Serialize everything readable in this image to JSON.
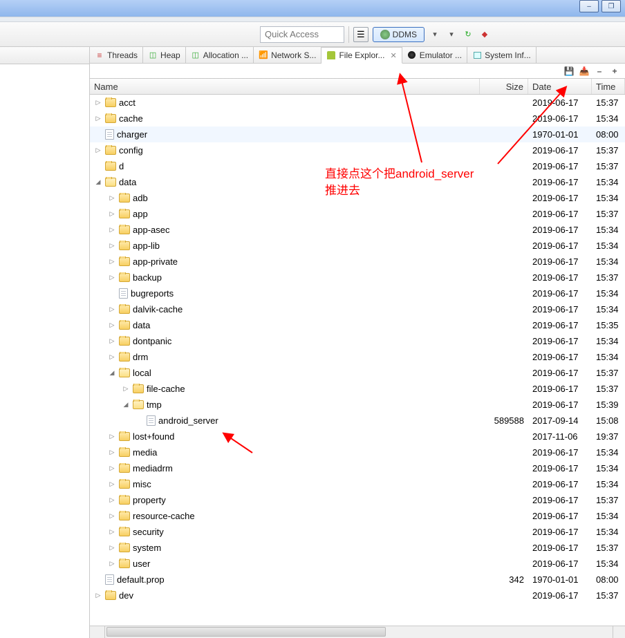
{
  "window": {
    "minimize": "–",
    "maximize": "❐"
  },
  "toolbar": {
    "quick_access_placeholder": "Quick Access",
    "ddms_label": "DDMS"
  },
  "tabs": [
    {
      "icon": "threads-icon",
      "label": "Threads"
    },
    {
      "icon": "heap-icon",
      "label": "Heap"
    },
    {
      "icon": "allocation-icon",
      "label": "Allocation ..."
    },
    {
      "icon": "network-icon",
      "label": "Network S..."
    },
    {
      "icon": "android-icon",
      "label": "File Explor...",
      "active": true,
      "closable": true
    },
    {
      "icon": "emulator-icon",
      "label": "Emulator ..."
    },
    {
      "icon": "system-icon",
      "label": "System Inf..."
    }
  ],
  "columns": {
    "name": "Name",
    "size": "Size",
    "date": "Date",
    "time": "Time"
  },
  "tree": [
    {
      "d": 0,
      "k": "fc",
      "n": "acct",
      "s": "",
      "dt": "2019-06-17",
      "tm": "15:37"
    },
    {
      "d": 0,
      "k": "fc",
      "n": "cache",
      "s": "",
      "dt": "2019-06-17",
      "tm": "15:34"
    },
    {
      "d": 0,
      "k": "fi",
      "n": "charger",
      "s": "",
      "dt": "1970-01-01",
      "tm": "08:00",
      "sel": true,
      "leaf": true
    },
    {
      "d": 0,
      "k": "fc",
      "n": "config",
      "s": "",
      "dt": "2019-06-17",
      "tm": "15:37"
    },
    {
      "d": 0,
      "k": "f",
      "n": "d",
      "s": "",
      "dt": "2019-06-17",
      "tm": "15:37",
      "leaf": true
    },
    {
      "d": 0,
      "k": "fo",
      "n": "data",
      "s": "",
      "dt": "2019-06-17",
      "tm": "15:34"
    },
    {
      "d": 1,
      "k": "fc",
      "n": "adb",
      "s": "",
      "dt": "2019-06-17",
      "tm": "15:34"
    },
    {
      "d": 1,
      "k": "fc",
      "n": "app",
      "s": "",
      "dt": "2019-06-17",
      "tm": "15:37"
    },
    {
      "d": 1,
      "k": "fc",
      "n": "app-asec",
      "s": "",
      "dt": "2019-06-17",
      "tm": "15:34"
    },
    {
      "d": 1,
      "k": "fc",
      "n": "app-lib",
      "s": "",
      "dt": "2019-06-17",
      "tm": "15:34"
    },
    {
      "d": 1,
      "k": "fc",
      "n": "app-private",
      "s": "",
      "dt": "2019-06-17",
      "tm": "15:34"
    },
    {
      "d": 1,
      "k": "fc",
      "n": "backup",
      "s": "",
      "dt": "2019-06-17",
      "tm": "15:37"
    },
    {
      "d": 1,
      "k": "fi",
      "n": "bugreports",
      "s": "",
      "dt": "2019-06-17",
      "tm": "15:34",
      "leaf": true
    },
    {
      "d": 1,
      "k": "fc",
      "n": "dalvik-cache",
      "s": "",
      "dt": "2019-06-17",
      "tm": "15:34"
    },
    {
      "d": 1,
      "k": "fc",
      "n": "data",
      "s": "",
      "dt": "2019-06-17",
      "tm": "15:35"
    },
    {
      "d": 1,
      "k": "fc",
      "n": "dontpanic",
      "s": "",
      "dt": "2019-06-17",
      "tm": "15:34"
    },
    {
      "d": 1,
      "k": "fc",
      "n": "drm",
      "s": "",
      "dt": "2019-06-17",
      "tm": "15:34"
    },
    {
      "d": 1,
      "k": "fo",
      "n": "local",
      "s": "",
      "dt": "2019-06-17",
      "tm": "15:37"
    },
    {
      "d": 2,
      "k": "fc",
      "n": "file-cache",
      "s": "",
      "dt": "2019-06-17",
      "tm": "15:37"
    },
    {
      "d": 2,
      "k": "fo",
      "n": "tmp",
      "s": "",
      "dt": "2019-06-17",
      "tm": "15:39"
    },
    {
      "d": 3,
      "k": "fi",
      "n": "android_server",
      "s": "589588",
      "dt": "2017-09-14",
      "tm": "15:08",
      "leaf": true
    },
    {
      "d": 1,
      "k": "fc",
      "n": "lost+found",
      "s": "",
      "dt": "2017-11-06",
      "tm": "19:37"
    },
    {
      "d": 1,
      "k": "fc",
      "n": "media",
      "s": "",
      "dt": "2019-06-17",
      "tm": "15:34"
    },
    {
      "d": 1,
      "k": "fc",
      "n": "mediadrm",
      "s": "",
      "dt": "2019-06-17",
      "tm": "15:34"
    },
    {
      "d": 1,
      "k": "fc",
      "n": "misc",
      "s": "",
      "dt": "2019-06-17",
      "tm": "15:34"
    },
    {
      "d": 1,
      "k": "fc",
      "n": "property",
      "s": "",
      "dt": "2019-06-17",
      "tm": "15:37"
    },
    {
      "d": 1,
      "k": "fc",
      "n": "resource-cache",
      "s": "",
      "dt": "2019-06-17",
      "tm": "15:34"
    },
    {
      "d": 1,
      "k": "fc",
      "n": "security",
      "s": "",
      "dt": "2019-06-17",
      "tm": "15:34"
    },
    {
      "d": 1,
      "k": "fc",
      "n": "system",
      "s": "",
      "dt": "2019-06-17",
      "tm": "15:37"
    },
    {
      "d": 1,
      "k": "fc",
      "n": "user",
      "s": "",
      "dt": "2019-06-17",
      "tm": "15:34"
    },
    {
      "d": 0,
      "k": "fi",
      "n": "default.prop",
      "s": "342",
      "dt": "1970-01-01",
      "tm": "08:00",
      "leaf": true
    },
    {
      "d": 0,
      "k": "fc",
      "n": "dev",
      "s": "",
      "dt": "2019-06-17",
      "tm": "15:37"
    }
  ],
  "annotations": {
    "text_line1": "直接点这个把android_server",
    "text_line2": "推进去"
  }
}
